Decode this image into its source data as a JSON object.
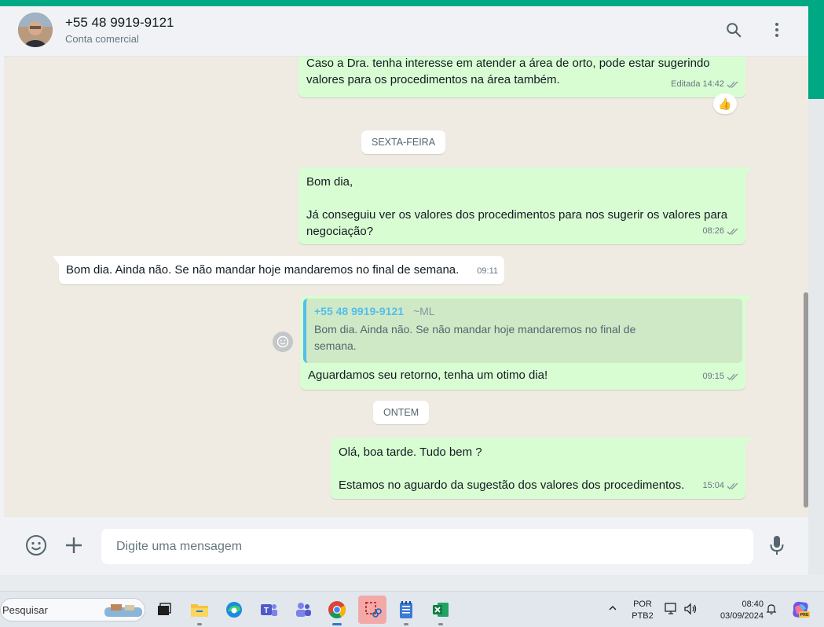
{
  "header": {
    "contact_name": "+55 48 9919-9121",
    "contact_subtitle": "Conta comercial"
  },
  "messages": [
    {
      "type": "out",
      "text": "Caso a Dra. tenha interesse em atender a área de orto, pode estar sugerindo\nvalores para os procedimentos na área também.",
      "edited_label": "Editada",
      "time": "14:42",
      "reaction": "👍"
    },
    {
      "type": "day",
      "text": "SEXTA-FEIRA"
    },
    {
      "type": "out",
      "text": "Bom dia,\n\nJá conseguiu ver os valores dos procedimentos para nos sugerir os valores para\nnegociação?",
      "time": "08:26"
    },
    {
      "type": "in",
      "text": "Bom dia. Ainda não. Se não mandar hoje mandaremos no final de semana.",
      "time": "09:11"
    },
    {
      "type": "out",
      "quote_author": "+55 48 9919-9121",
      "quote_author_name": "~ML",
      "quote_text": "Bom dia. Ainda não. Se não mandar hoje mandaremos no final de\nsemana.",
      "text": "Aguardamos seu retorno, tenha um otimo dia!",
      "time": "09:15"
    },
    {
      "type": "day",
      "text": "ONTEM"
    },
    {
      "type": "out",
      "text": "Olá, boa tarde. Tudo bem ?\n\nEstamos no aguardo da sugestão dos valores dos procedimentos.",
      "time": "15:04"
    }
  ],
  "composer": {
    "placeholder": "Digite uma mensagem"
  },
  "taskbar": {
    "search_label": "Pesquisar",
    "lang_top": "POR",
    "lang_bottom": "PTB2",
    "time": "08:40",
    "date": "03/09/2024"
  },
  "colors": {
    "accent": "#00a884",
    "outgoing_bubble": "#d9fdd3",
    "incoming_bubble": "#ffffff",
    "chat_background": "#efeae2",
    "quote_author": "#53bdeb",
    "read_ticks": "#8696a0"
  },
  "icons": [
    "search-icon",
    "menu-icon",
    "emoji-icon",
    "attach-icon",
    "mic-icon",
    "double-check-icon",
    "thumbs-up-icon"
  ]
}
